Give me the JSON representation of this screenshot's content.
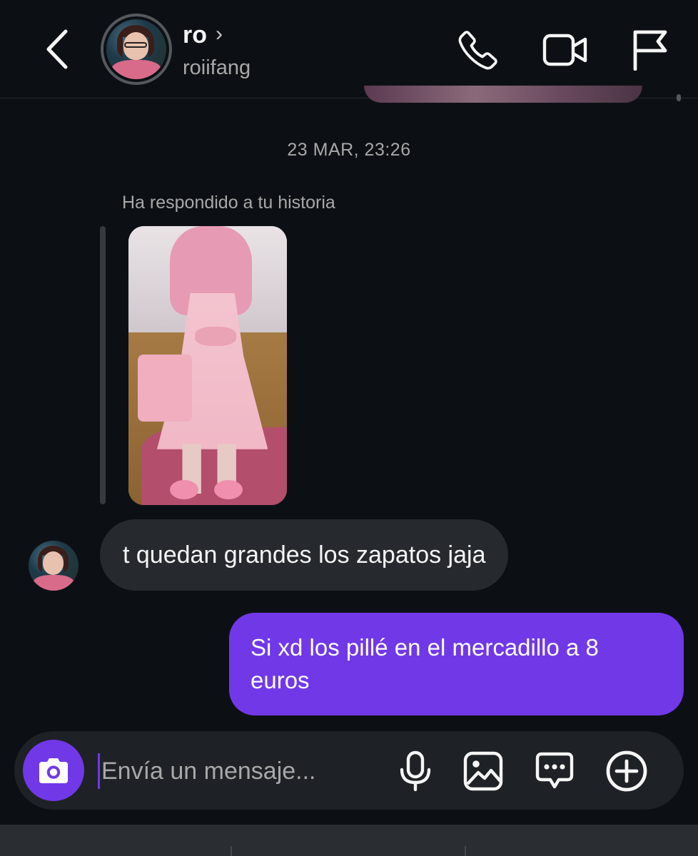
{
  "header": {
    "contact_name": "ro",
    "username": "roiifang",
    "icons": {
      "back": "chevron-left-icon",
      "chevron": "chevron-right-icon",
      "call": "phone-icon",
      "video": "video-camera-icon",
      "report": "flag-icon"
    },
    "chevron_glyph": "›"
  },
  "chat": {
    "timestamp": "23 MAR, 23:26",
    "story_reply_label": "Ha respondido a tu historia",
    "messages": [
      {
        "from": "ro",
        "text": "t quedan grandes los zapatos jaja"
      },
      {
        "from": "me",
        "text": "Si xd los pillé en el mercadillo a 8 euros"
      }
    ]
  },
  "composer": {
    "placeholder": "Envía un mensaje...",
    "icons": {
      "camera": "camera-icon",
      "mic": "microphone-icon",
      "gallery": "image-icon",
      "chat_menu": "message-dots-icon",
      "add": "plus-circle-icon"
    }
  },
  "colors": {
    "background": "#0c1014",
    "incoming_bubble": "#262a2f",
    "outgoing_bubble": "#7138e8",
    "accent": "#7138e8",
    "secondary_text": "#a8a8a8"
  }
}
